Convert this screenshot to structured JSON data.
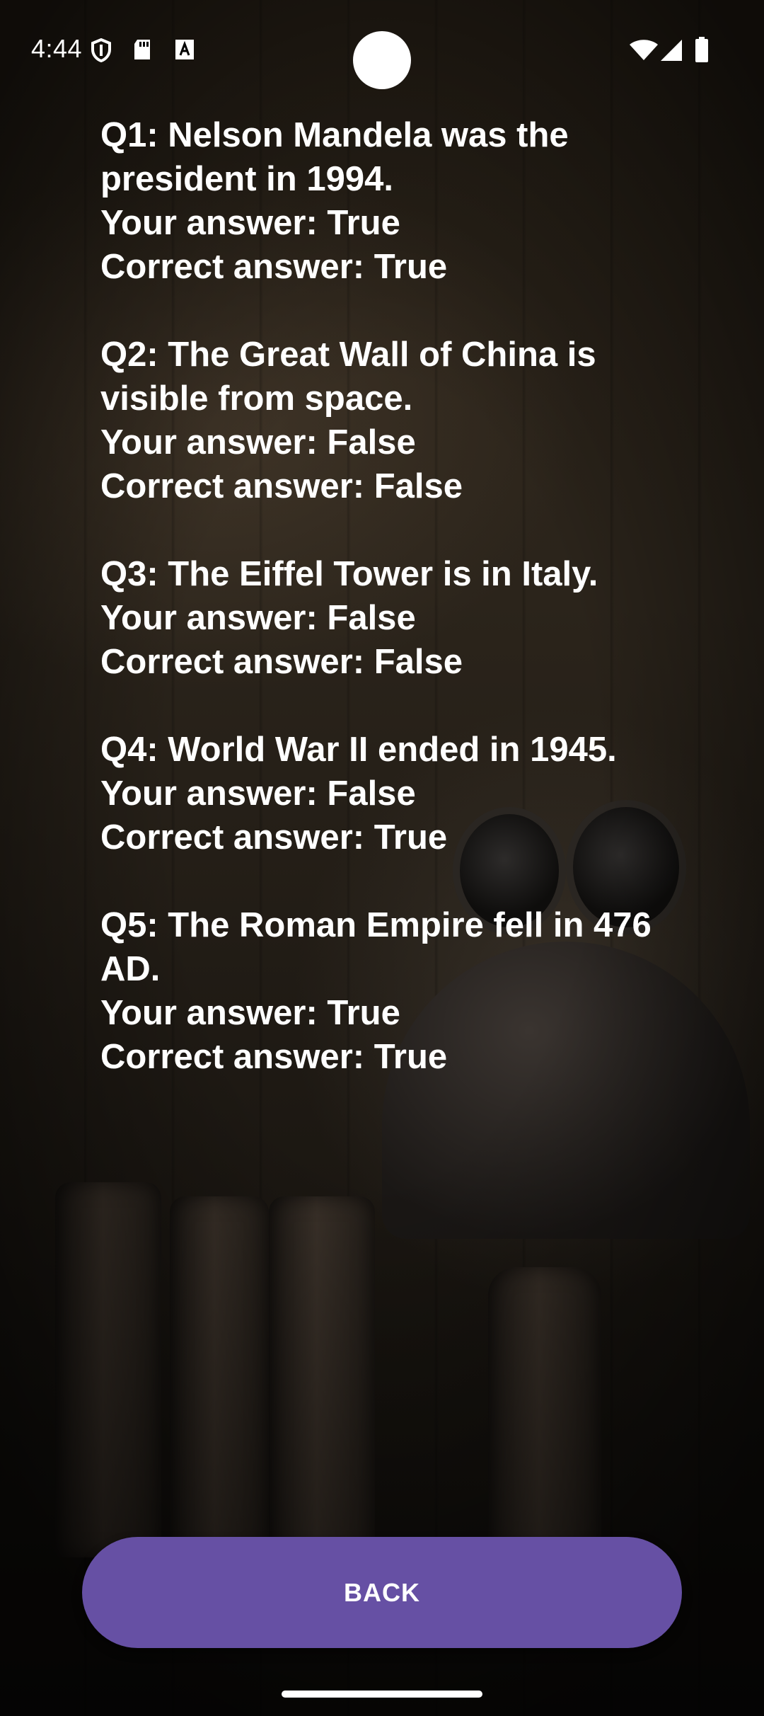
{
  "status_bar": {
    "time": "4:44",
    "icons_left": [
      "shield-icon",
      "sd-card-icon",
      "font-download-icon"
    ],
    "icons_right": [
      "wifi-icon",
      "signal-icon",
      "battery-icon"
    ]
  },
  "results": [
    {
      "question": "Q1: Nelson Mandela was the president in 1994.",
      "your_answer": "Your answer: True",
      "correct_answer": "Correct answer: True"
    },
    {
      "question": "Q2: The Great Wall of China is visible from space.",
      "your_answer": "Your answer: False",
      "correct_answer": "Correct answer: False"
    },
    {
      "question": "Q3: The Eiffel Tower is in Italy.",
      "your_answer": "Your answer: False",
      "correct_answer": "Correct answer: False"
    },
    {
      "question": "Q4: World War II ended in 1945.",
      "your_answer": "Your answer: False",
      "correct_answer": "Correct answer: True"
    },
    {
      "question": "Q5: The Roman Empire fell in 476 AD.",
      "your_answer": "Your answer: True",
      "correct_answer": "Correct answer: True"
    }
  ],
  "back_button": {
    "label": "BACK"
  },
  "colors": {
    "button": "#6650a4",
    "text": "#ffffff"
  }
}
